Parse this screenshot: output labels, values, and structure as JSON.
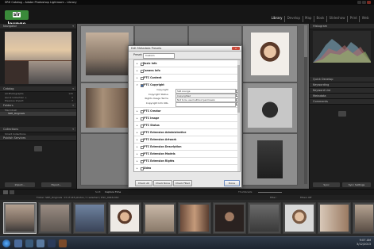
{
  "window_title": "SRH Catalog - Adobe Photoshop Lightroom - Library",
  "logo": {
    "prefix": "slr",
    "suffix": "lounge"
  },
  "modules": [
    "Library",
    "Develop",
    "Map",
    "Book",
    "Slideshow",
    "Print",
    "Web"
  ],
  "active_module": "Library",
  "left_panel": {
    "navigator": "Navigator",
    "catalog": {
      "title": "Catalog",
      "items": [
        {
          "label": "All Photographs",
          "count": "145"
        },
        {
          "label": "Quick Collection +",
          "count": "0"
        },
        {
          "label": "Previous Import",
          "count": "7"
        }
      ]
    },
    "folders": {
      "title": "Folders",
      "items": [
        {
          "label": "Macintosh",
          "count": ""
        },
        {
          "label": "SRH_Originals",
          "count": ""
        }
      ]
    },
    "collections": {
      "title": "Collections",
      "items": [
        {
          "label": "Smart Collections"
        }
      ]
    },
    "publish": "Publish Services",
    "import_btn": "Import...",
    "export_btn": "Export..."
  },
  "right_panel": {
    "histogram": "Histogram",
    "quick_develop": "Quick Develop",
    "keywording": "Keywording",
    "keyword_list": "Keyword List",
    "metadata": "Metadata",
    "comments": "Comments",
    "sync_btn": "Sync",
    "sync_settings_btn": "Sync Settings"
  },
  "toolbar": {
    "sort_label": "Sort:",
    "sort_value": "Capture Time",
    "thumbs": "Thumbnails"
  },
  "filmstrip_bar": {
    "path": "Folder: SRH_Originals",
    "info": "13 of 145 photos / 1 selected / DSC_0046.CR2",
    "filter": "Filter :",
    "filter_value": "Filters Off"
  },
  "dialog": {
    "title": "Edit Metadata Presets",
    "close": "x",
    "preset_label": "Preset:",
    "preset_value": "Custom",
    "sections": [
      {
        "label": "Basic Info",
        "open": false
      },
      {
        "label": "Camera Info",
        "open": false
      },
      {
        "label": "IPTC Content",
        "open": false
      },
      {
        "label": "IPTC Copyright",
        "open": true
      },
      {
        "label": "IPTC Creator",
        "open": false
      },
      {
        "label": "IPTC Image",
        "open": false
      },
      {
        "label": "IPTC Status",
        "open": false
      },
      {
        "label": "IPTC Extension Administrative",
        "open": false
      },
      {
        "label": "IPTC Extension Artwork",
        "open": false
      },
      {
        "label": "IPTC Extension Description",
        "open": false
      },
      {
        "label": "IPTC Extension Models",
        "open": false
      },
      {
        "label": "IPTC Extension Rights",
        "open": false
      },
      {
        "label": "Video",
        "open": false
      }
    ],
    "copyright_fields": [
      {
        "label": "Copyright",
        "value": "SLR Lounge"
      },
      {
        "label": "Copyright Status",
        "value": "Copyrighted"
      },
      {
        "label": "Rights Usage Terms",
        "value": "Not to be used without permission"
      },
      {
        "label": "Copyright Info URL",
        "value": ""
      }
    ],
    "buttons": {
      "check_all": "Check All",
      "check_none": "Check None",
      "check_filled": "Check Filled",
      "done": "Done"
    }
  },
  "taskbar": {
    "time": "9:07 AM",
    "date": "3/12/2013"
  },
  "colors": {
    "accent_green": "#3a8a3a",
    "dialog_bg": "#e7e7e7",
    "grid_bg": "#5f5f5f"
  }
}
